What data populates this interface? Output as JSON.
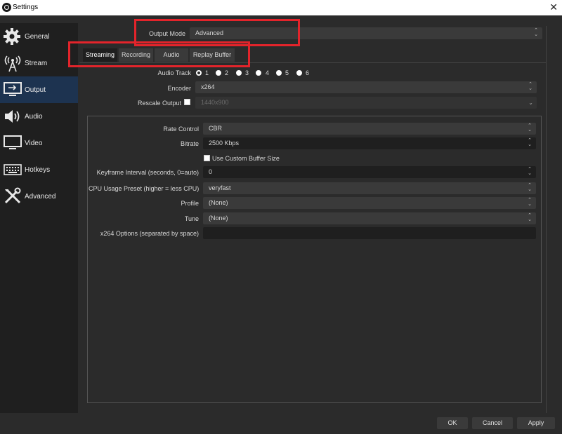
{
  "window": {
    "title": "Settings",
    "close_glyph": "✕"
  },
  "sidebar": {
    "items": [
      {
        "label": "General",
        "icon": "gear-icon"
      },
      {
        "label": "Stream",
        "icon": "broadcast-icon"
      },
      {
        "label": "Output",
        "icon": "monitor-output-icon"
      },
      {
        "label": "Audio",
        "icon": "speaker-icon"
      },
      {
        "label": "Video",
        "icon": "monitor-icon"
      },
      {
        "label": "Hotkeys",
        "icon": "keyboard-icon"
      },
      {
        "label": "Advanced",
        "icon": "tools-icon"
      }
    ],
    "active": "Output"
  },
  "output_mode": {
    "label": "Output Mode",
    "value": "Advanced"
  },
  "tabs": [
    {
      "label": "Streaming",
      "active": true
    },
    {
      "label": "Recording"
    },
    {
      "label": "Audio"
    },
    {
      "label": "Replay Buffer"
    }
  ],
  "streaming": {
    "audio_track_label": "Audio Track",
    "audio_tracks": [
      "1",
      "2",
      "3",
      "4",
      "5",
      "6"
    ],
    "audio_track_selected": "1",
    "encoder_label": "Encoder",
    "encoder_value": "x264",
    "rescale_label": "Rescale Output",
    "rescale_value": "1440x900",
    "rescale_checked": false
  },
  "encoder_settings": {
    "rate_control_label": "Rate Control",
    "rate_control_value": "CBR",
    "bitrate_label": "Bitrate",
    "bitrate_value": "2500 Kbps",
    "custom_buffer_label": "Use Custom Buffer Size",
    "custom_buffer_checked": false,
    "keyframe_label": "Keyframe Interval (seconds, 0=auto)",
    "keyframe_value": "0",
    "cpu_preset_label": "CPU Usage Preset (higher = less CPU)",
    "cpu_preset_value": "veryfast",
    "profile_label": "Profile",
    "profile_value": "(None)",
    "tune_label": "Tune",
    "tune_value": "(None)",
    "x264_options_label": "x264 Options (separated by space)",
    "x264_options_value": ""
  },
  "buttons": {
    "ok": "OK",
    "cancel": "Cancel",
    "apply": "Apply"
  },
  "colors": {
    "highlight": "#e3242b",
    "active_sidebar": "#1d3350"
  }
}
